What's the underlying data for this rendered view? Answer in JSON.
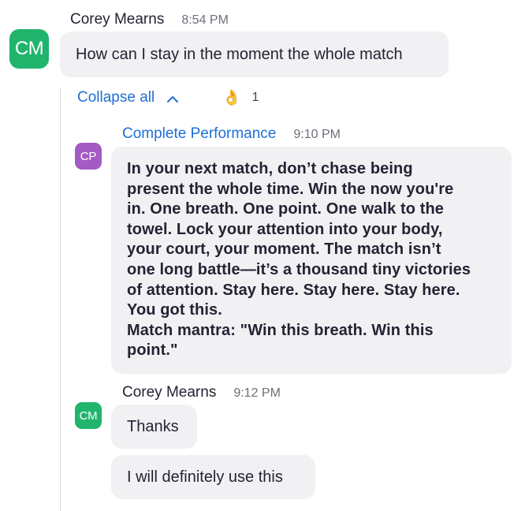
{
  "messages": [
    {
      "avatar_initials": "CM",
      "author": "Corey Mearns",
      "time": "8:54 PM",
      "text": "How can I stay in the moment the whole match"
    }
  ],
  "thread": {
    "collapse_label": "Collapse all",
    "reaction": {
      "emoji": "👌",
      "count": "1",
      "icon": "ok-hand-emoji"
    },
    "replies": [
      {
        "avatar_initials": "CP",
        "author": "Complete Performance",
        "time": "9:10 PM",
        "lines": [
          "In your next match, don’t chase being",
          "present the whole time. Win the now you're",
          "in. One breath. One point. One walk to the",
          "towel. Lock your attention into your body,",
          "your court, your moment. The match isn’t",
          "one long battle—it’s a thousand tiny victories",
          "of attention. Stay here. Stay here. Stay here.",
          "You got this.",
          "Match mantra: \"Win this breath. Win this",
          "point.\""
        ]
      },
      {
        "avatar_initials": "CM",
        "author": "Corey Mearns",
        "time": "9:12 PM",
        "messages": [
          "Thanks",
          "I will definitely use this"
        ]
      }
    ]
  },
  "colors": {
    "link": "#1f6fd6",
    "bubble": "#f1f1f4",
    "avatar_green": "#21b46d",
    "avatar_purple": "#a45bc4"
  }
}
